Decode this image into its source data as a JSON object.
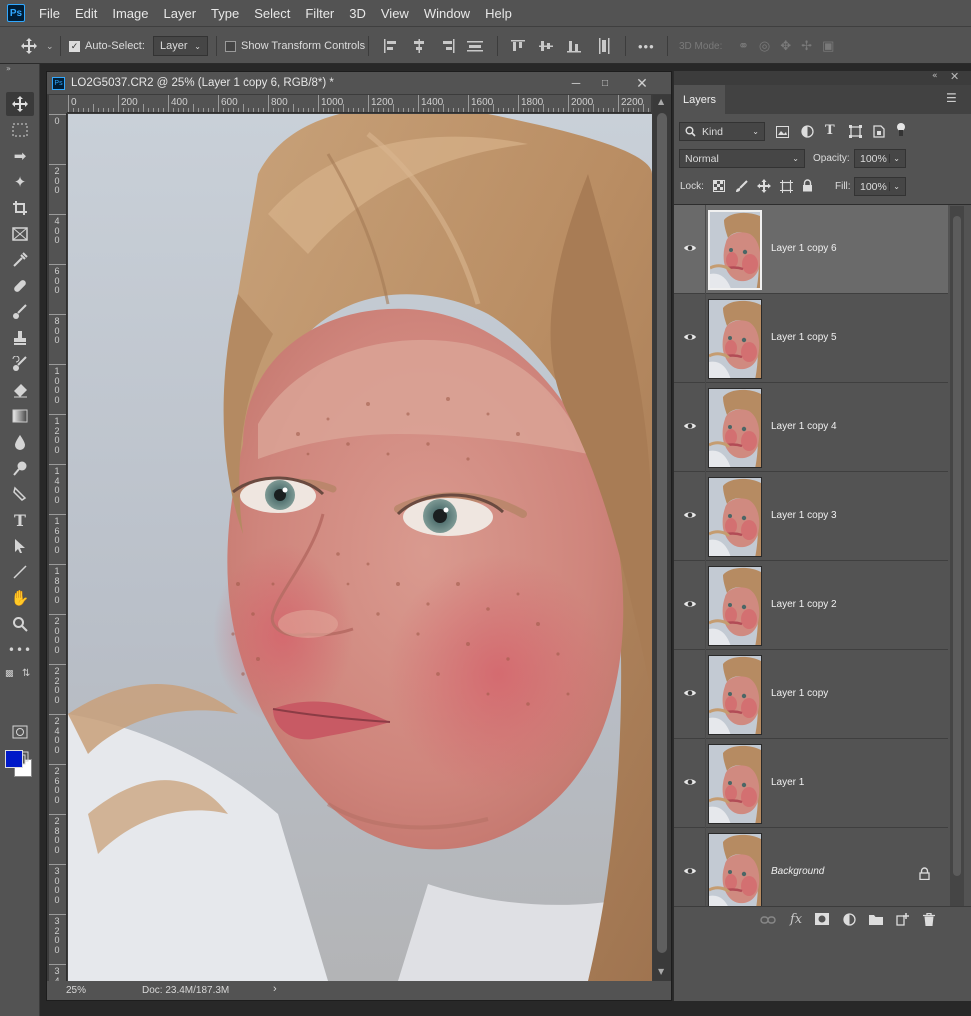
{
  "menubar": {
    "logo": "Ps",
    "items": [
      "File",
      "Edit",
      "Image",
      "Layer",
      "Type",
      "Select",
      "Filter",
      "3D",
      "View",
      "Window",
      "Help"
    ]
  },
  "options": {
    "auto_select_label": "Auto-Select:",
    "auto_select_checked": true,
    "auto_select_target": "Layer",
    "show_transform_label": "Show Transform Controls",
    "show_transform_checked": false,
    "more": "•••",
    "mode_3d_label": "3D Mode:"
  },
  "tools": [
    "move-tool",
    "marquee-tool",
    "lasso-tool",
    "quick-select-tool",
    "crop-tool",
    "frame-tool",
    "eyedropper-tool",
    "healing-brush-tool",
    "brush-tool",
    "clone-stamp-tool",
    "history-brush-tool",
    "eraser-tool",
    "gradient-tool",
    "blur-tool",
    "dodge-tool",
    "pen-tool",
    "type-tool",
    "path-select-tool",
    "line-tool",
    "hand-tool",
    "zoom-tool",
    "more-tools"
  ],
  "colors": {
    "foreground": "#0019c8",
    "background": "#ffffff"
  },
  "document": {
    "title": "LO2G5037.CR2 @ 25% (Layer 1 copy 6, RGB/8*) *",
    "ruler_h": [
      "0",
      "200",
      "400",
      "600",
      "800",
      "1000",
      "1200",
      "1400",
      "1600",
      "1800",
      "2000",
      "2200"
    ],
    "ruler_v": [
      "0",
      "2\n0\n0",
      "4\n0\n0",
      "6\n0\n0",
      "8\n0\n0",
      "1\n0\n0\n0",
      "1\n2\n0\n0",
      "1\n4\n0\n0",
      "1\n6\n0\n0",
      "1\n8\n0\n0",
      "2\n0\n0\n0",
      "2\n2\n0\n0",
      "2\n4\n0\n0",
      "2\n6\n0\n0",
      "2\n8\n0\n0",
      "3\n0\n0\n0",
      "3\n2\n0\n0",
      "3\n4"
    ],
    "zoom": "25%",
    "doc_size": "Doc: 23.4M/187.3M"
  },
  "layers_panel": {
    "tab": "Layers",
    "filter_kind": "Kind",
    "blend_mode": "Normal",
    "opacity_label": "Opacity:",
    "opacity": "100%",
    "lock_label": "Lock:",
    "fill_label": "Fill:",
    "fill": "100%",
    "layers": [
      {
        "name": "Layer 1 copy 6",
        "selected": true,
        "italic": false,
        "locked": false
      },
      {
        "name": "Layer 1 copy 5",
        "selected": false,
        "italic": false,
        "locked": false
      },
      {
        "name": "Layer 1 copy 4",
        "selected": false,
        "italic": false,
        "locked": false
      },
      {
        "name": "Layer 1 copy 3",
        "selected": false,
        "italic": false,
        "locked": false
      },
      {
        "name": "Layer 1 copy 2",
        "selected": false,
        "italic": false,
        "locked": false
      },
      {
        "name": "Layer 1 copy",
        "selected": false,
        "italic": false,
        "locked": false
      },
      {
        "name": "Layer 1",
        "selected": false,
        "italic": false,
        "locked": false
      },
      {
        "name": "Background",
        "selected": false,
        "italic": true,
        "locked": true
      }
    ],
    "bottom_fx": "fx"
  }
}
